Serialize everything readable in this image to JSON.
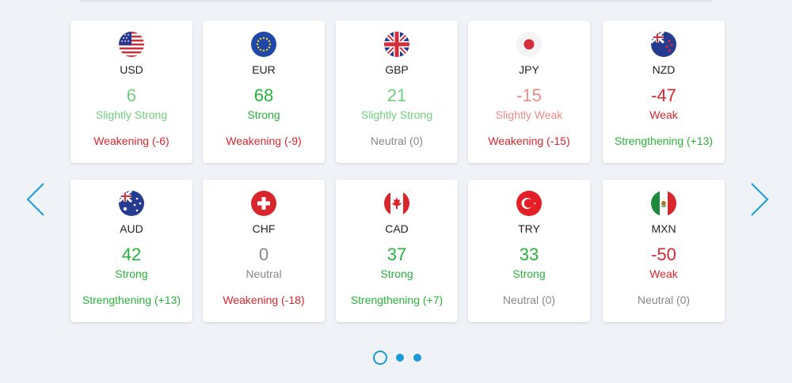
{
  "cards": [
    {
      "code": "USD",
      "score": "6",
      "label": "Slightly Strong",
      "trend": "Weakening (-6)",
      "icon": "us-flag-icon"
    },
    {
      "code": "EUR",
      "score": "68",
      "label": "Strong",
      "trend": "Weakening (-9)",
      "icon": "eu-flag-icon"
    },
    {
      "code": "GBP",
      "score": "21",
      "label": "Slightly Strong",
      "trend": "Neutral (0)",
      "icon": "uk-flag-icon"
    },
    {
      "code": "JPY",
      "score": "-15",
      "label": "Slightly Weak",
      "trend": "Weakening (-15)",
      "icon": "japan-flag-icon"
    },
    {
      "code": "NZD",
      "score": "-47",
      "label": "Weak",
      "trend": "Strengthening (+13)",
      "icon": "new-zealand-flag-icon"
    },
    {
      "code": "AUD",
      "score": "42",
      "label": "Strong",
      "trend": "Strengthening (+13)",
      "icon": "australia-flag-icon"
    },
    {
      "code": "CHF",
      "score": "0",
      "label": "Neutral",
      "trend": "Weakening (-18)",
      "icon": "switzerland-flag-icon"
    },
    {
      "code": "CAD",
      "score": "37",
      "label": "Strong",
      "trend": "Strengthening (+7)",
      "icon": "canada-flag-icon"
    },
    {
      "code": "TRY",
      "score": "33",
      "label": "Strong",
      "trend": "Neutral (0)",
      "icon": "turkey-flag-icon"
    },
    {
      "code": "MXN",
      "score": "-50",
      "label": "Weak",
      "trend": "Neutral (0)",
      "icon": "mexico-flag-icon"
    }
  ],
  "colors": {
    "strong": "#27b33a",
    "slightly_strong": "#6fcf7c",
    "weak": "#d9262d",
    "slightly_weak": "#ee8a88",
    "neutral": "#888888",
    "accent": "#1a9bd7",
    "background": "#eff2f6"
  },
  "carousel": {
    "prev_icon": "chevron-left-icon",
    "next_icon": "chevron-right-icon",
    "pages": 3,
    "active_page": 1
  }
}
